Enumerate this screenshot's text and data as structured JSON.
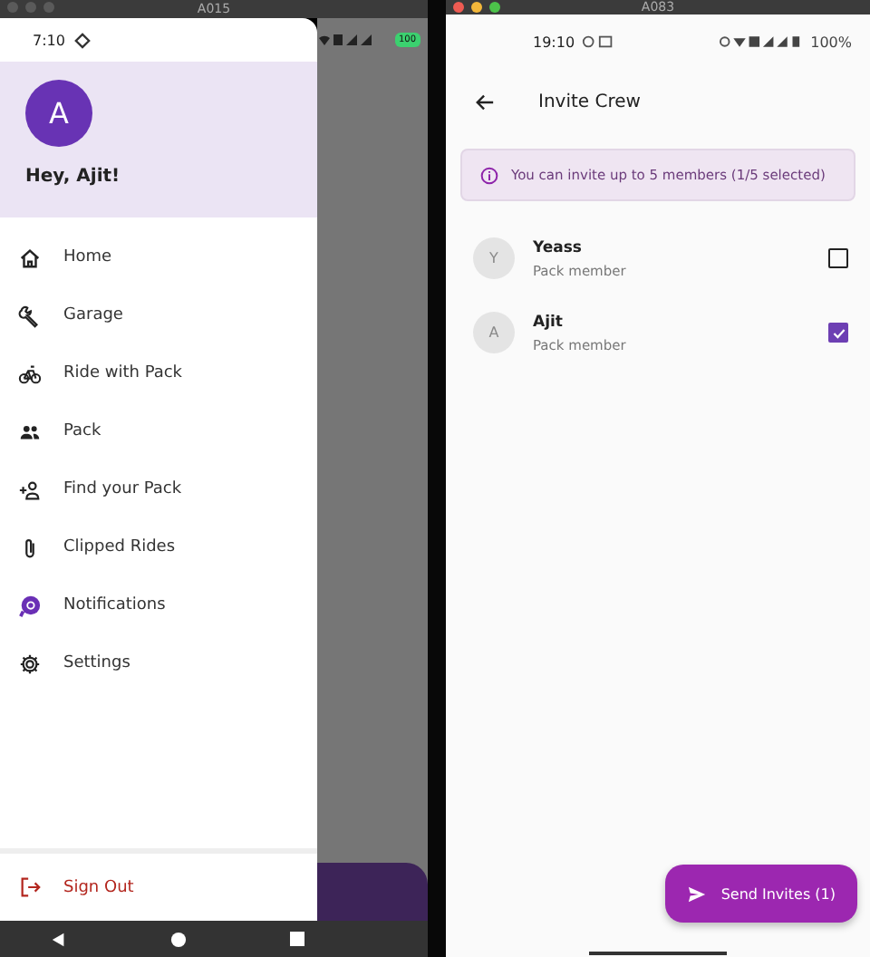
{
  "left_window": {
    "title": "A015",
    "status_bar": {
      "time": "7:10",
      "battery": "100"
    },
    "drawer": {
      "avatar": "A",
      "greeting": "Hey, Ajit!",
      "items": [
        {
          "kind": "home",
          "label": "Home"
        },
        {
          "kind": "wrench",
          "label": "Garage"
        },
        {
          "kind": "bike",
          "label": "Ride with Pack"
        },
        {
          "kind": "group",
          "label": "Pack"
        },
        {
          "kind": "add-person",
          "label": "Find your Pack"
        },
        {
          "kind": "clip",
          "label": "Clipped Rides"
        },
        {
          "kind": "bell",
          "label": "Notifications"
        },
        {
          "kind": "gear",
          "label": "Settings"
        }
      ],
      "sign_out": "Sign Out"
    }
  },
  "right_window": {
    "title": "A083",
    "status_bar": {
      "time": "19:10",
      "battery": "100%"
    },
    "app_bar": {
      "title": "Invite Crew"
    },
    "info": "You can invite up to 5 members (1/5 selected)",
    "members": [
      {
        "initial": "Y",
        "name": "Yeass",
        "role": "Pack member",
        "checked": false
      },
      {
        "initial": "A",
        "name": "Ajit",
        "role": "Pack member",
        "checked": true
      }
    ],
    "fab": "Send Invites (1)"
  }
}
